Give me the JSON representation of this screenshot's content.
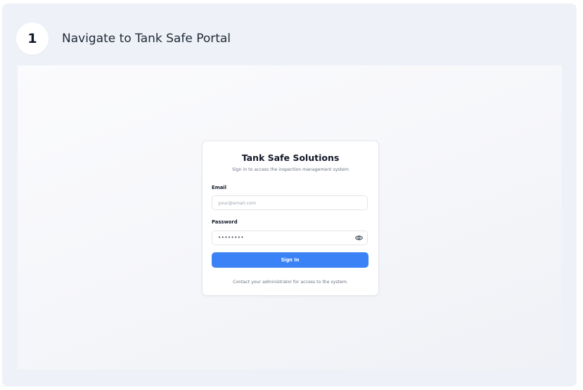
{
  "step": {
    "number": "1",
    "title": "Navigate to Tank Safe Portal"
  },
  "login": {
    "title": "Tank Safe Solutions",
    "subtitle": "Sign in to access the inspection management system",
    "email_label": "Email",
    "email_placeholder": "your@email.com",
    "password_label": "Password",
    "password_value": "••••••••",
    "sign_in_label": "Sign In",
    "footer_note": "Contact your administrator for access to the system."
  },
  "colors": {
    "accent": "#3b82f6",
    "background": "#eef1f7"
  },
  "icons": {
    "show_password": "eye-icon"
  }
}
